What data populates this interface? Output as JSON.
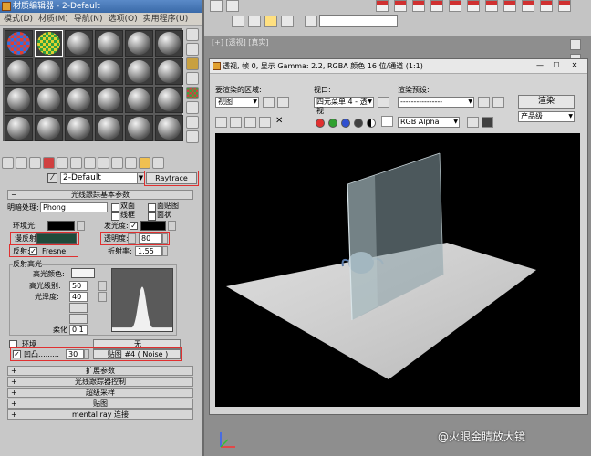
{
  "material_editor": {
    "title": "材质编辑器 - 2-Default",
    "menu": [
      "模式(D)",
      "材质(M)",
      "导航(N)",
      "选项(O)",
      "实用程序(U)"
    ],
    "material_name": "2-Default",
    "material_type": "Raytrace",
    "rollouts": {
      "basic": "光线跟踪基本参数",
      "extended": "扩展参数",
      "controls": "光线跟踪器控制",
      "supersampling": "超级采样",
      "maps": "贴图",
      "mental_ray": "mental ray 连接"
    },
    "shading_label": "明暗处理:",
    "shading_value": "Phong",
    "shading_options": {
      "two_sided": "双面",
      "wire": "线框",
      "face_map": "面贴图",
      "faceted": "面状"
    },
    "ambient_label": "环境光:",
    "diffuse_label": "漫反射:",
    "reflect_label": "反射:",
    "reflect_value": "Fresnel",
    "luminosity_label": "发光度:",
    "transparency_label": "透明度:",
    "transparency_value": "80",
    "ior_label": "折射率:",
    "ior_value": "1.55",
    "spec_group": "反射高光",
    "spec_color_label": "高光颜色:",
    "spec_level_label": "高光级别:",
    "spec_level_value": "50",
    "gloss_label": "光泽度:",
    "gloss_value": "40",
    "soften_label": "柔化",
    "soften_value": "0.1",
    "env_label": "环境",
    "env_value": "无",
    "bump_label": "凹凸.........",
    "bump_amount": "30",
    "bump_map": "贴图 #4 ( Noise )",
    "colors": {
      "ambient": "#000000",
      "diffuse": "#1f4a3a",
      "luminosity": "#000000",
      "transparency": "#000000",
      "spec": "#f4f4f4"
    }
  },
  "viewport": {
    "label": "[+] [透视] [真实]"
  },
  "render_window": {
    "title": "透视, 帧 0, 显示 Gamma: 2.2, RGBA 颜色 16 位/通道 (1:1)",
    "area_label": "要渲染的区域:",
    "area_value": "视图",
    "viewport_label": "视口:",
    "viewport_value": "四元菜单 4 - 透视",
    "preset_label": "渲染预设:",
    "preset_value": "----------------",
    "render_button": "渲染",
    "quality_value": "产品级",
    "channel_value": "RGB Alpha",
    "channel_colors": [
      "#e03030",
      "#30a030",
      "#3050d0",
      "#404040"
    ]
  },
  "watermark": "@火眼金睛放大镜"
}
